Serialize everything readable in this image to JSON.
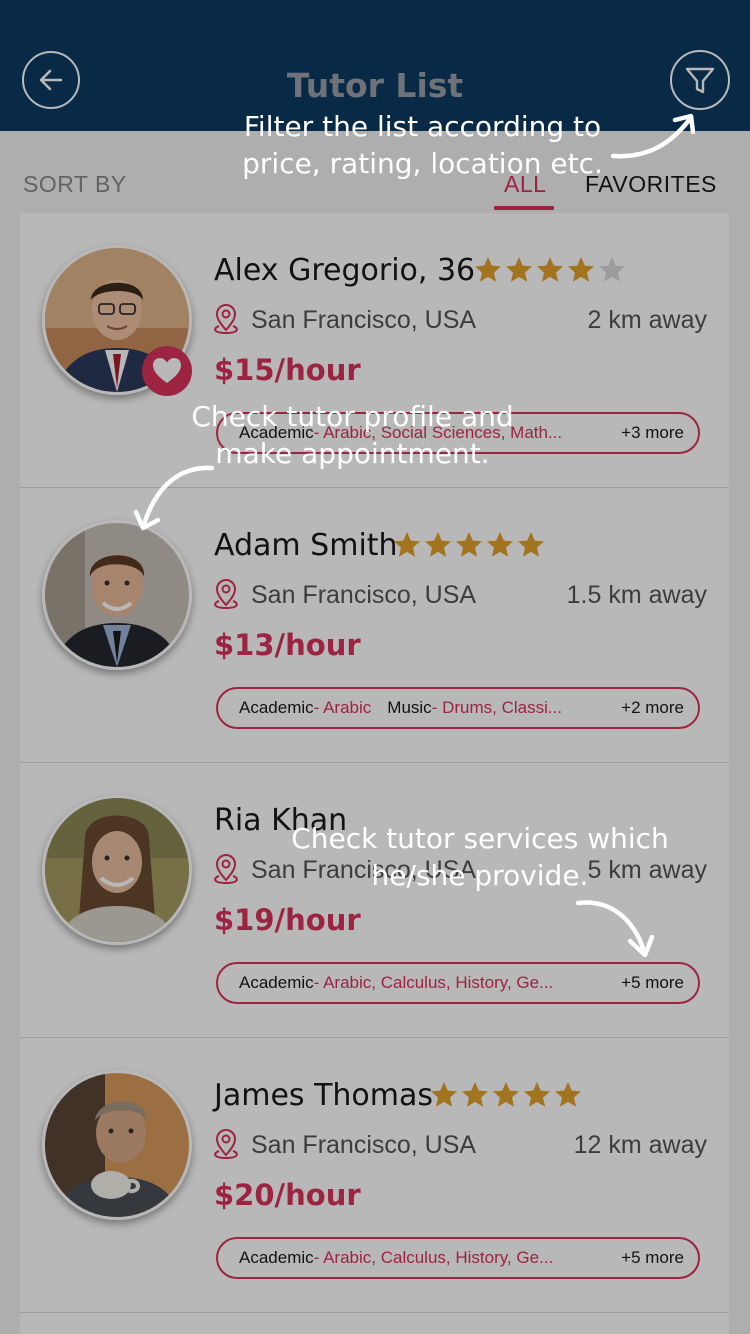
{
  "header": {
    "title": "Tutor List",
    "back_icon": "arrow-left-icon",
    "filter_icon": "funnel-icon"
  },
  "sort": {
    "label": "SORT BY",
    "tabs": [
      "ALL",
      "FAVORITES"
    ],
    "active_tab": "ALL"
  },
  "colors": {
    "header_bg": "#0c3b63",
    "accent": "#d8335b",
    "star": "#e2a12b",
    "star_empty": "#d9d9d9"
  },
  "tutors": [
    {
      "name": "Alex Gregorio, 36",
      "rating": 4,
      "favorite": true,
      "location": "San Francisco, USA",
      "distance": "2 km away",
      "price": "$15/hour",
      "services": [
        {
          "category": "Academic",
          "subjects": " - Arabic, Social Sciences, Math..."
        }
      ],
      "more": "+3 more"
    },
    {
      "name": "Adam Smith",
      "rating": 5,
      "favorite": false,
      "location": "San Francisco, USA",
      "distance": "1.5 km away",
      "price": "$13/hour",
      "services": [
        {
          "category": "Academic",
          "subjects": " - Arabic"
        },
        {
          "category": "Music",
          "subjects": " - Drums, Classi..."
        }
      ],
      "more": "+2 more"
    },
    {
      "name": "Ria Khan",
      "rating": 0,
      "favorite": false,
      "location": "San Francisco, USA",
      "distance": "5 km away",
      "price": "$19/hour",
      "services": [
        {
          "category": "Academic",
          "subjects": " - Arabic, Calculus, History, Ge..."
        }
      ],
      "more": "+5 more"
    },
    {
      "name": "James Thomas",
      "rating": 5,
      "favorite": false,
      "location": "San Francisco, USA",
      "distance": "12 km away",
      "price": "$20/hour",
      "services": [
        {
          "category": "Academic",
          "subjects": " - Arabic, Calculus, History, Ge..."
        }
      ],
      "more": "+5 more"
    }
  ],
  "hints": {
    "filter": [
      "Filter the list according to",
      "price, rating, location etc."
    ],
    "profile": [
      "Check tutor profile and",
      "make appointment."
    ],
    "services": [
      "Check tutor services which",
      "he/she provide."
    ]
  }
}
